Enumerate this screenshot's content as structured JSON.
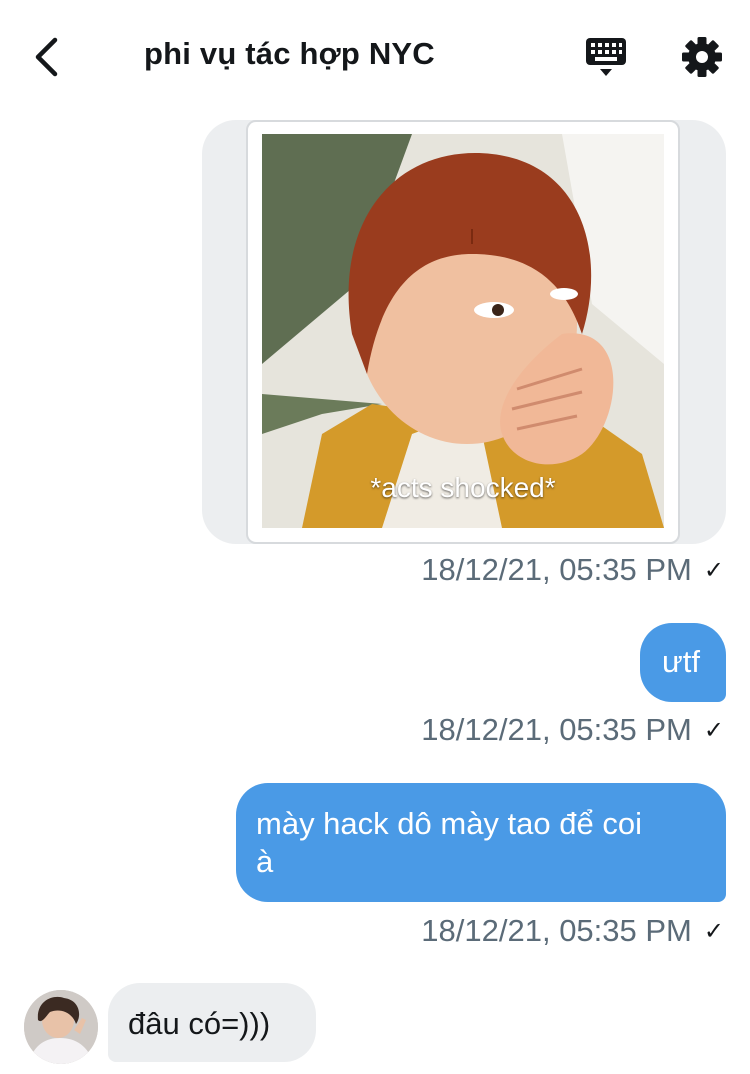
{
  "header": {
    "title": "phi vụ tác hợp NYC",
    "back_icon": "chevron-left-icon",
    "keyboard_icon": "keyboard-icon",
    "settings_icon": "gear-icon"
  },
  "messages": [
    {
      "type": "media",
      "caption": "*acts shocked*",
      "timestamp": "18/12/21, 05:35 PM",
      "status": "✓"
    },
    {
      "type": "text",
      "text": "ưtf",
      "timestamp": "18/12/21, 05:35 PM",
      "status": "✓"
    },
    {
      "type": "text",
      "text_line1": "mày hack dô mày tao để coi",
      "text_line2": "à",
      "timestamp": "18/12/21, 05:35 PM",
      "status": "✓"
    },
    {
      "type": "received",
      "text": "đâu có=)))"
    }
  ],
  "colors": {
    "sent_bubble": "#4a9ae6",
    "received_bubble": "#eceef0",
    "timestamp": "#5b6b78"
  }
}
